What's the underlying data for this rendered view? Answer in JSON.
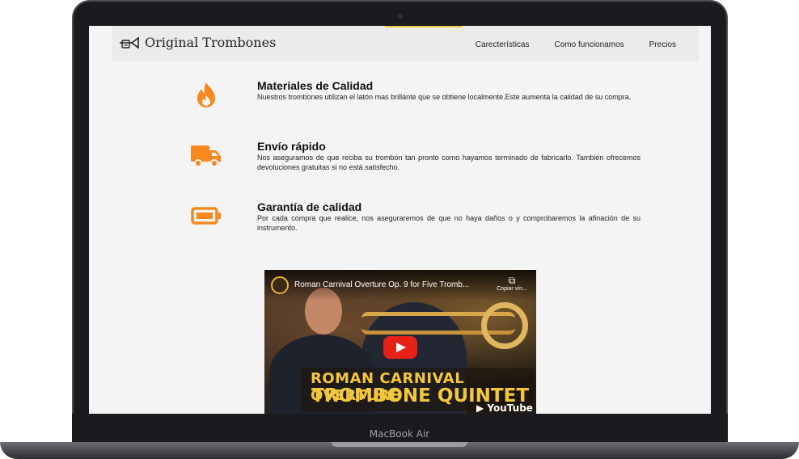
{
  "device": {
    "label": "MacBook Air"
  },
  "navbar": {
    "brand": "Original Trombones",
    "links": [
      "Carecterísticas",
      "Como funcionamos",
      "Precios"
    ],
    "accent_color": "#f2c53d"
  },
  "features": [
    {
      "icon": "flame-icon",
      "title": "Materiales de Calidad",
      "description": "Nuestros trombones utilizan el latón mas brillante que se obtiene localmente.Este aumenta la calidad de su compra."
    },
    {
      "icon": "truck-icon",
      "title": "Envío rápido",
      "description": "Nos aseguramos de que reciba su trombón tan pronto como hayamos terminado de fabricarlo. También ofrecemos devoluciones gratuitas si no está satisfecho."
    },
    {
      "icon": "battery-icon",
      "title": "Garantía de calidad",
      "description": "Por cada compra que realice, nos aseguraremos de que no haya daños o y comprobaremos la afinación de su instrumento."
    }
  ],
  "icon_color": "#f7891e",
  "video": {
    "title": "Roman Carnival Overture Op. 9 for Five Tromb...",
    "copy_label": "Copiar vín...",
    "banner_line1": "ROMAN CARNIVAL OVERTURE",
    "banner_line2": "TROMBONE QUINTET",
    "platform": "YouTube"
  }
}
